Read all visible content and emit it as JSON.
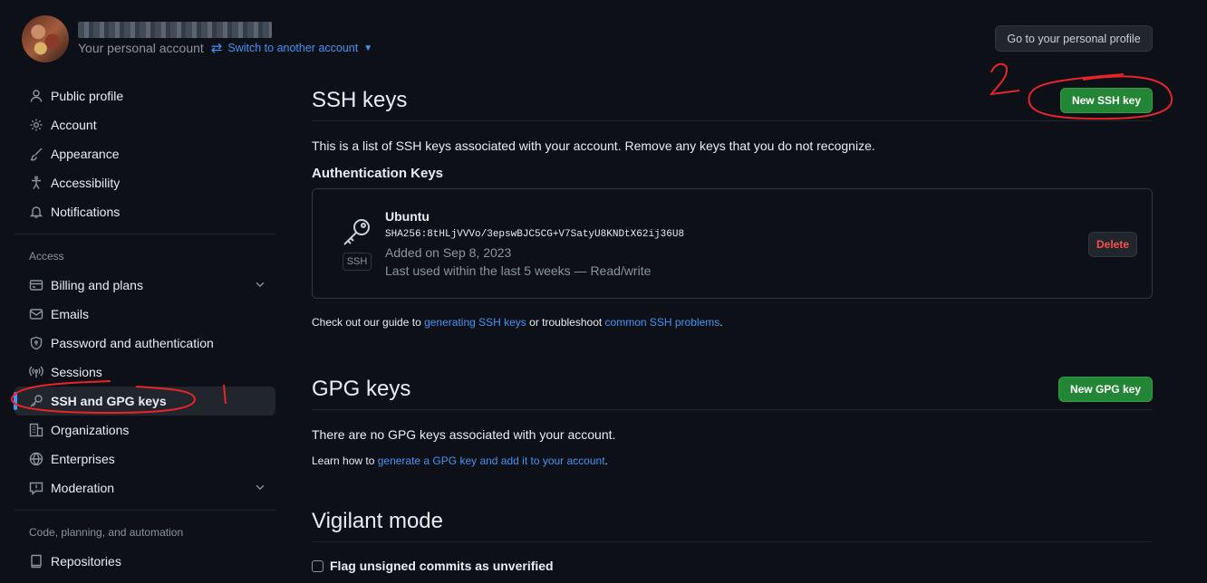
{
  "account": {
    "personal_label": "Your personal account",
    "switch_label": "Switch to another account",
    "profile_button": "Go to your personal profile"
  },
  "sidebar": {
    "items": [
      {
        "label": "Public profile",
        "icon": "person-icon"
      },
      {
        "label": "Account",
        "icon": "gear-icon"
      },
      {
        "label": "Appearance",
        "icon": "paintbrush-icon"
      },
      {
        "label": "Accessibility",
        "icon": "accessibility-icon"
      },
      {
        "label": "Notifications",
        "icon": "bell-icon"
      }
    ],
    "access_heading": "Access",
    "access_items": [
      {
        "label": "Billing and plans",
        "icon": "credit-card-icon"
      },
      {
        "label": "Emails",
        "icon": "mail-icon"
      },
      {
        "label": "Password and authentication",
        "icon": "shield-lock-icon"
      },
      {
        "label": "Sessions",
        "icon": "broadcast-icon"
      },
      {
        "label": "SSH and GPG keys",
        "icon": "key-icon"
      },
      {
        "label": "Organizations",
        "icon": "organization-icon"
      },
      {
        "label": "Enterprises",
        "icon": "globe-icon"
      },
      {
        "label": "Moderation",
        "icon": "report-icon"
      }
    ],
    "code_heading": "Code, planning, and automation",
    "code_items": [
      {
        "label": "Repositories",
        "icon": "repo-icon"
      }
    ]
  },
  "ssh": {
    "title": "SSH keys",
    "new_button": "New SSH key",
    "description": "This is a list of SSH keys associated with your account. Remove any keys that you do not recognize.",
    "subheading": "Authentication Keys",
    "key": {
      "badge": "SSH",
      "title": "Ubuntu",
      "fingerprint": "SHA256:8tHLjVVVo/3epswBJC5CG+V7SatyU8KNDtX62ij36U8",
      "added": "Added on Sep 8, 2023",
      "last_used": "Last used within the last 5 weeks — Read/write",
      "delete_button": "Delete"
    },
    "guide_pre": "Check out our guide to ",
    "guide_link1": "generating SSH keys",
    "guide_mid": " or troubleshoot ",
    "guide_link2": "common SSH problems",
    "guide_post": "."
  },
  "gpg": {
    "title": "GPG keys",
    "new_button": "New GPG key",
    "empty": "There are no GPG keys associated with your account.",
    "learn_pre": "Learn how to ",
    "learn_link": "generate a GPG key and add it to your account",
    "learn_post": "."
  },
  "vigilant": {
    "title": "Vigilant mode",
    "checkbox_label": "Flag unsigned commits as unverified"
  },
  "annotations": {
    "label_1": "1",
    "label_2": "2",
    "color": "#e5252a"
  }
}
